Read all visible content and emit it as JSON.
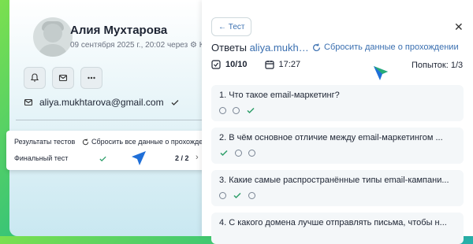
{
  "profile": {
    "name": "Алия Мухтарова",
    "meta": "09 сентября 2025 г., 20:02 через",
    "source": "Ку",
    "email": "aliya.mukhtarova@gmail.com"
  },
  "popup": {
    "col1": "Результаты тестов",
    "reset": "Сбросить все данные о прохождении",
    "row2": "Финальный тест",
    "score": "2 / 2"
  },
  "panel": {
    "back": "← Тест",
    "answers_label": "Ответы",
    "username": "aliya.mukh…",
    "reset": "Сбросить данные о прохождении",
    "score": "10/10",
    "time": "17:27",
    "attempts": "Попыток: 1/3",
    "questions": [
      {
        "title": "1. Что такое email-маркетинг?"
      },
      {
        "title": "2. В чём основное отличие между email-маркетингом ..."
      },
      {
        "title": "3. Какие самые распространённые типы email-кампани..."
      },
      {
        "title": "4.  С какого домена лучше отправлять письма, чтобы н..."
      }
    ]
  },
  "colors": {
    "accent": "#3a6fb0",
    "check": "#2e9e6a",
    "cursor": "#1f6fd8"
  }
}
